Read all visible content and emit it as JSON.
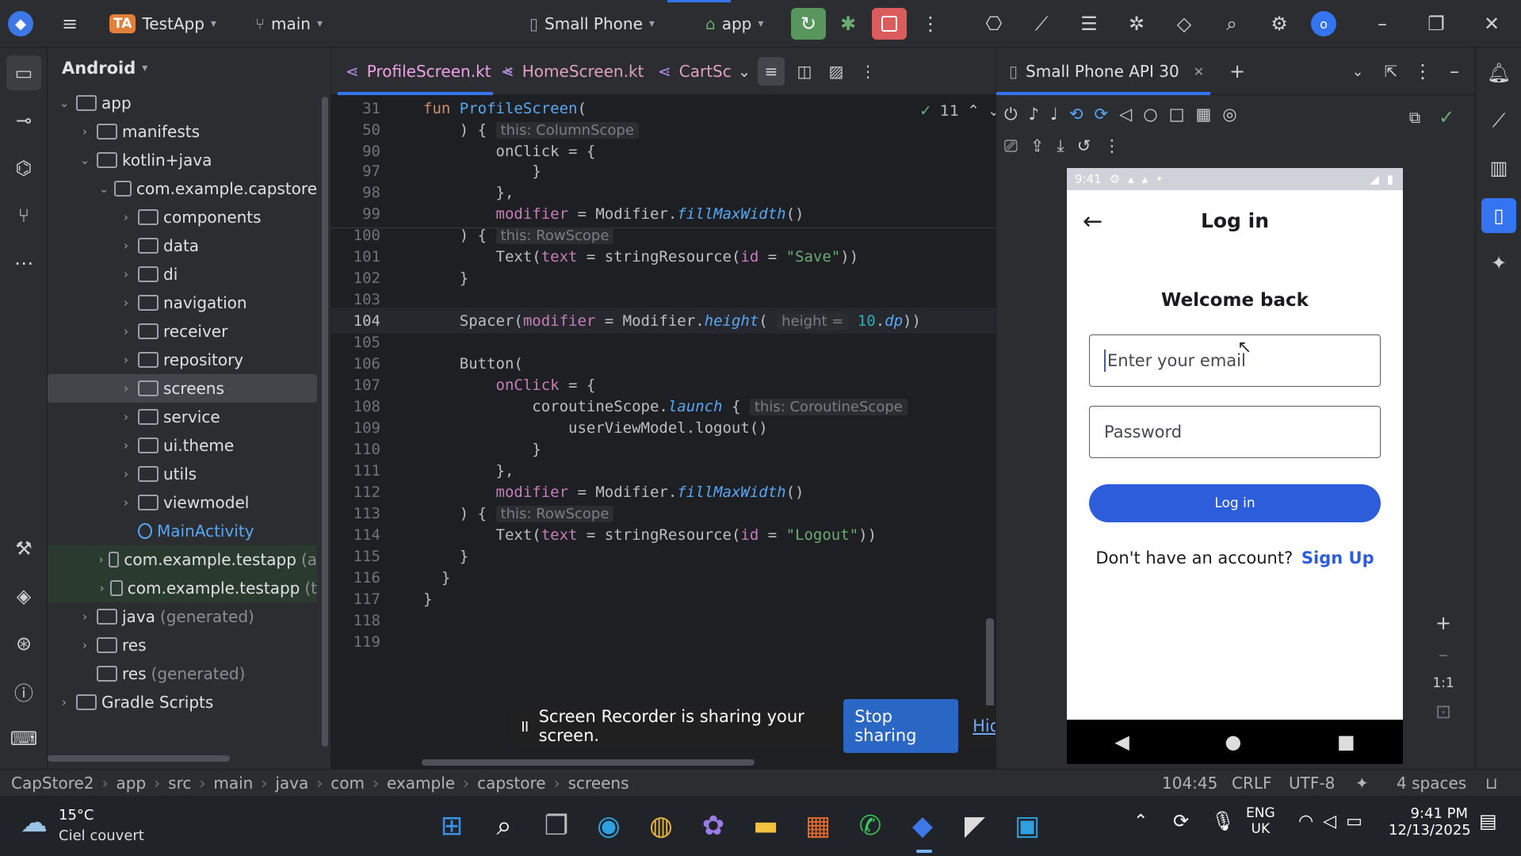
{
  "titlebar": {
    "project_badge": "TA",
    "project_name": "TestApp",
    "branch": "main",
    "device": "Small Phone",
    "run_config": "app",
    "badge": "o"
  },
  "project_panel": {
    "title": "Android",
    "tree": [
      {
        "label": "app",
        "depth": 0,
        "expanded": true,
        "gen": ""
      },
      {
        "label": "manifests",
        "depth": 1,
        "expanded": false,
        "gen": ""
      },
      {
        "label": "kotlin+java",
        "depth": 1,
        "expanded": true,
        "gen": ""
      },
      {
        "label": "com.example.capstore",
        "depth": 2,
        "expanded": true,
        "gen": ""
      },
      {
        "label": "components",
        "depth": 3,
        "expanded": false,
        "gen": ""
      },
      {
        "label": "data",
        "depth": 3,
        "expanded": false,
        "gen": ""
      },
      {
        "label": "di",
        "depth": 3,
        "expanded": false,
        "gen": ""
      },
      {
        "label": "navigation",
        "depth": 3,
        "expanded": false,
        "gen": ""
      },
      {
        "label": "receiver",
        "depth": 3,
        "expanded": false,
        "gen": ""
      },
      {
        "label": "repository",
        "depth": 3,
        "expanded": false,
        "gen": ""
      },
      {
        "label": "screens",
        "depth": 3,
        "expanded": false,
        "gen": "",
        "selected": true
      },
      {
        "label": "service",
        "depth": 3,
        "expanded": false,
        "gen": ""
      },
      {
        "label": "ui.theme",
        "depth": 3,
        "expanded": false,
        "gen": ""
      },
      {
        "label": "utils",
        "depth": 3,
        "expanded": false,
        "gen": ""
      },
      {
        "label": "viewmodel",
        "depth": 3,
        "expanded": false,
        "gen": ""
      },
      {
        "label": "MainActivity",
        "depth": 3,
        "expanded": null,
        "gen": "",
        "file": true
      },
      {
        "label": "com.example.testapp",
        "depth": 2,
        "expanded": false,
        "gen": "(a",
        "green": true
      },
      {
        "label": "com.example.testapp",
        "depth": 2,
        "expanded": false,
        "gen": "(t",
        "green": true
      },
      {
        "label": "java",
        "depth": 1,
        "expanded": false,
        "gen": "(generated)"
      },
      {
        "label": "res",
        "depth": 1,
        "expanded": false,
        "gen": ""
      },
      {
        "label": "res",
        "depth": 1,
        "expanded": null,
        "gen": "(generated)"
      },
      {
        "label": "Gradle Scripts",
        "depth": 0,
        "expanded": false,
        "gen": ""
      }
    ]
  },
  "editor": {
    "tabs": [
      {
        "label": "ProfileScreen.kt",
        "active": true
      },
      {
        "label": "HomeScreen.kt",
        "active": false
      },
      {
        "label": "CartSc",
        "active": false
      }
    ],
    "problems": "11",
    "lines": [
      {
        "n": "31",
        "html": "<span class='kw'>fun </span><span class='fn'>ProfileScreen</span><span class='pl'>(</span>"
      },
      {
        "n": "50",
        "html": "<span class='pl'>    ) { </span><span class='hint'>this: ColumnScope</span>"
      },
      {
        "n": "90",
        "html": "<span class='pl'>        onClick = {</span>"
      },
      {
        "n": "97",
        "html": "<span class='pl'>            }</span>"
      },
      {
        "n": "98",
        "html": "<span class='pl'>        },</span>"
      },
      {
        "n": "99",
        "html": "<span class='nm'>        modifier</span><span class='pl'> = Modifier.</span><span class='it'>fillMaxWidth</span><span class='pl'>()</span>"
      },
      {
        "n": "100",
        "html": "<span class='pl'>    ) { </span><span class='hint'>this: RowScope</span>"
      },
      {
        "n": "101",
        "html": "<span class='pl'>        Text(</span><span class='nm'>text</span><span class='pl'> = stringResource(</span><span class='nm'>id</span><span class='pl'> = </span><span class='str'>\"Save\"</span><span class='pl'>))</span>"
      },
      {
        "n": "102",
        "html": "<span class='pl'>    }</span>"
      },
      {
        "n": "103",
        "html": ""
      },
      {
        "n": "104",
        "html": "<span class='pl'>    Spacer(</span><span class='nm'>modifier</span><span class='pl'> = Modifier.</span><span class='it'>height</span><span class='pl'>( </span><span class='hint'>height =</span><span class='num'> 10</span><span class='pl'>.</span><span class='it'>dp</span><span class='pl'>))</span>"
      },
      {
        "n": "105",
        "html": ""
      },
      {
        "n": "106",
        "html": "<span class='pl'>    Button(</span>"
      },
      {
        "n": "107",
        "html": "<span class='nm'>        onClick</span><span class='pl'> = {</span>"
      },
      {
        "n": "108",
        "html": "<span class='pl'>            coroutineScope.</span><span class='it'>launch</span><span class='pl'> { </span><span class='hint'>this: CoroutineScope</span>"
      },
      {
        "n": "109",
        "html": "<span class='pl'>                userViewModel.logout()</span>"
      },
      {
        "n": "110",
        "html": "<span class='pl'>            }</span>"
      },
      {
        "n": "111",
        "html": "<span class='pl'>        },</span>"
      },
      {
        "n": "112",
        "html": "<span class='nm'>        modifier</span><span class='pl'> = Modifier.</span><span class='it'>fillMaxWidth</span><span class='pl'>()</span>"
      },
      {
        "n": "113",
        "html": "<span class='pl'>    ) { </span><span class='hint'>this: RowScope</span>"
      },
      {
        "n": "114",
        "html": "<span class='pl'>        Text(</span><span class='nm'>text</span><span class='pl'> = stringResource(</span><span class='nm'>id</span><span class='pl'> = </span><span class='str'>\"Logout\"</span><span class='pl'>))</span>"
      },
      {
        "n": "115",
        "html": "<span class='pl'>    }</span>"
      },
      {
        "n": "116",
        "html": "<span class='pl'>  }</span>"
      },
      {
        "n": "117",
        "html": "<span class='pl'>}</span>"
      },
      {
        "n": "118",
        "html": ""
      },
      {
        "n": "119",
        "html": ""
      }
    ]
  },
  "share_banner": {
    "text": "Screen Recorder is sharing your screen.",
    "stop": "Stop sharing",
    "hide": "Hide"
  },
  "emulator": {
    "tab": "Small Phone API 30",
    "zoom_label": "1:1",
    "phone": {
      "time": "9:41",
      "title": "Log in",
      "welcome": "Welcome back",
      "email_placeholder": "Enter your email",
      "password_placeholder": "Password",
      "login_button": "Log in",
      "no_account": "Don't have an account?",
      "signup": "Sign Up"
    }
  },
  "statusbar": {
    "breadcrumb": [
      "CapStore2",
      "app",
      "src",
      "main",
      "java",
      "com",
      "example",
      "capstore",
      "screens"
    ],
    "position": "104:45",
    "line_sep": "CRLF",
    "encoding": "UTF-8",
    "indent": "4 spaces"
  },
  "taskbar": {
    "temp": "15°C",
    "weather": "Ciel couvert",
    "lang1": "ENG",
    "lang2": "UK",
    "time": "9:41 PM",
    "date": "12/13/2025"
  }
}
